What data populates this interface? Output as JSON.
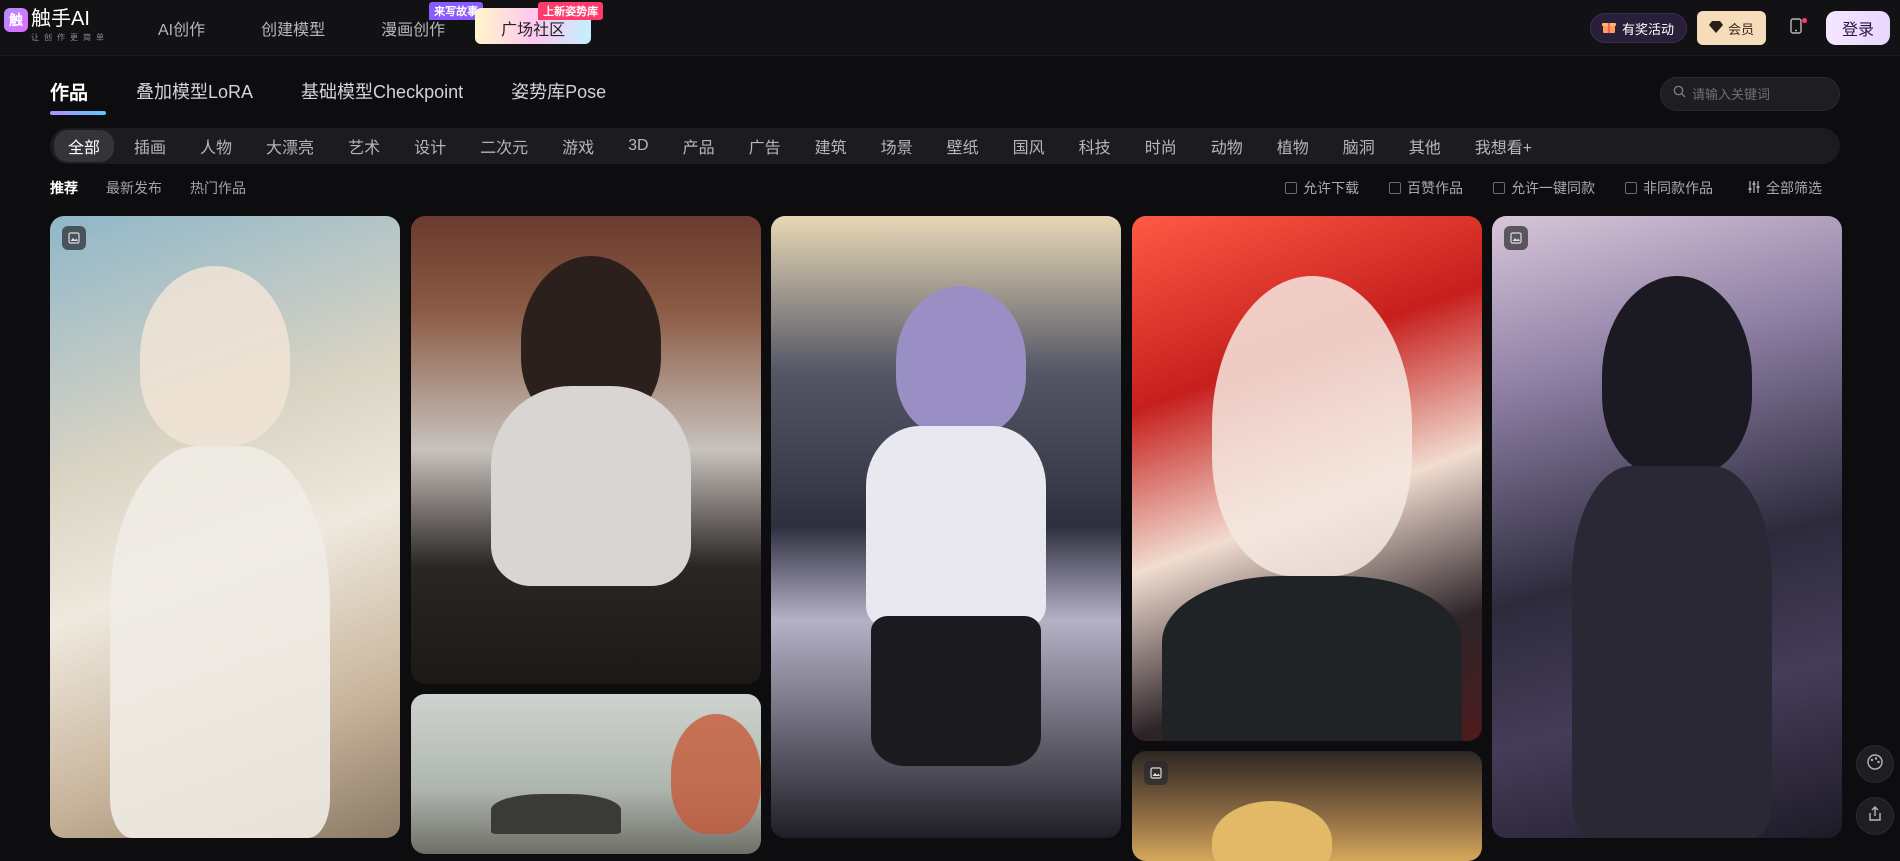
{
  "brand": {
    "name": "触手AI",
    "tagline": "让创作更简单"
  },
  "nav": {
    "items": [
      {
        "label": "AI创作",
        "badge": ""
      },
      {
        "label": "创建模型",
        "badge": ""
      },
      {
        "label": "漫画创作",
        "badge": "来写故事"
      },
      {
        "label": "广场社区",
        "badge": "上新姿势库"
      }
    ]
  },
  "header": {
    "promo_label": "有奖活动",
    "vip_label": "会员",
    "login_label": "登录"
  },
  "tabs": [
    "作品",
    "叠加模型LoRA",
    "基础模型Checkpoint",
    "姿势库Pose"
  ],
  "search": {
    "placeholder": "请输入关键词"
  },
  "categories": [
    "全部",
    "插画",
    "人物",
    "大漂亮",
    "艺术",
    "设计",
    "二次元",
    "游戏",
    "3D",
    "产品",
    "广告",
    "建筑",
    "场景",
    "壁纸",
    "国风",
    "科技",
    "时尚",
    "动物",
    "植物",
    "脑洞",
    "其他",
    "我想看+"
  ],
  "sort_options": [
    "推荐",
    "最新发布",
    "热门作品"
  ],
  "filters": [
    "允许下载",
    "百赞作品",
    "允许一键同款",
    "非同款作品"
  ],
  "filter_all_label": "全部筛选",
  "colors": {
    "accent_purple": "#8c5bff",
    "badge_red": "#ff3b6b",
    "vip_gold": "#f7dcbb"
  },
  "icons": [
    "gift-icon",
    "diamond-icon",
    "phone-icon",
    "search-icon",
    "filter-icon",
    "image-icon",
    "palette-icon",
    "share-icon"
  ]
}
